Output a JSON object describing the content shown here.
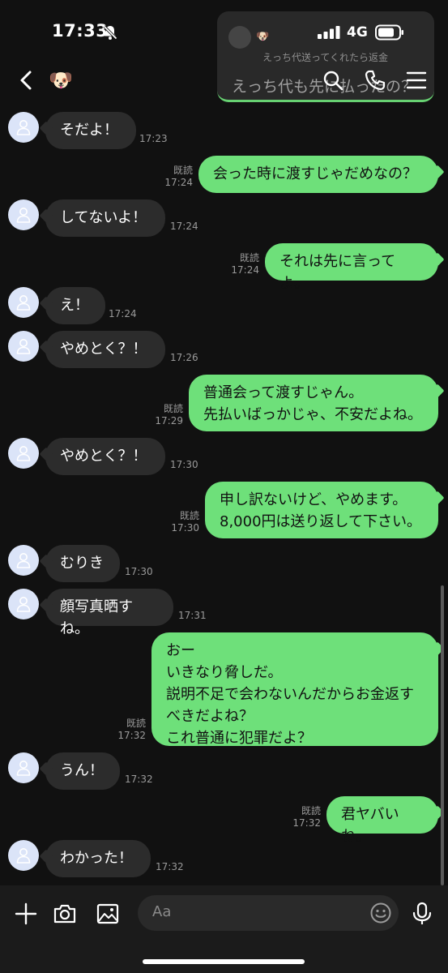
{
  "status_bar": {
    "time": "17:33",
    "network": "4G"
  },
  "header": {
    "contact_emoji": "🐶"
  },
  "notification": {
    "sender_emoji": "🐶",
    "preview_line1": "えっち代送ってくれたら返金",
    "preview_line2": "えっち代も先に払ったの？"
  },
  "messages": [
    {
      "side": "in",
      "text": "そだよ！",
      "time": "17:23"
    },
    {
      "side": "out",
      "text": "会った時に渡すじゃだめなの？",
      "read": "既読",
      "time": "17:24"
    },
    {
      "side": "in",
      "text": "してないよ！",
      "time": "17:24"
    },
    {
      "side": "out",
      "text": "それは先に言ってよ。",
      "read": "既読",
      "time": "17:24"
    },
    {
      "side": "in",
      "text": "え！",
      "time": "17:24"
    },
    {
      "side": "in",
      "text": "やめとく？！",
      "time": "17:26"
    },
    {
      "side": "out",
      "text": "普通会って渡すじゃん。\n先払いばっかじゃ、不安だよね。",
      "read": "既読",
      "time": "17:29"
    },
    {
      "side": "in",
      "text": "やめとく？！",
      "time": "17:30"
    },
    {
      "side": "out",
      "text": "申し訳ないけど、やめます。\n8,000円は送り返して下さい。",
      "read": "既読",
      "time": "17:30"
    },
    {
      "side": "in",
      "text": "むりき",
      "time": "17:30"
    },
    {
      "side": "in",
      "text": "顔写真晒すね。",
      "time": "17:31"
    },
    {
      "side": "out",
      "text": "おー\nいきなり脅しだ。\n説明不足で会わないんだからお金返す\nべきだよね？\nこれ普通に犯罪だよ？",
      "read": "既読",
      "time": "17:32"
    },
    {
      "side": "in",
      "text": "うん！",
      "time": "17:32"
    },
    {
      "side": "out",
      "text": "君ヤバいね。",
      "read": "既読",
      "time": "17:32"
    },
    {
      "side": "in",
      "text": "わかった！",
      "time": "17:32"
    }
  ],
  "composer": {
    "placeholder": "Aa"
  },
  "icons": {
    "status": [
      "bell-off-icon",
      "signal-icon",
      "battery-icon"
    ],
    "header": [
      "back-icon",
      "search-icon",
      "phone-icon",
      "menu-icon"
    ],
    "composer": [
      "plus-icon",
      "camera-icon",
      "image-icon",
      "emoji-icon",
      "mic-icon"
    ]
  },
  "colors": {
    "background": "#111111",
    "incoming_bubble": "#2c2c2c",
    "outgoing_bubble": "#6ee07a",
    "meta_text": "#9a9a9a"
  }
}
